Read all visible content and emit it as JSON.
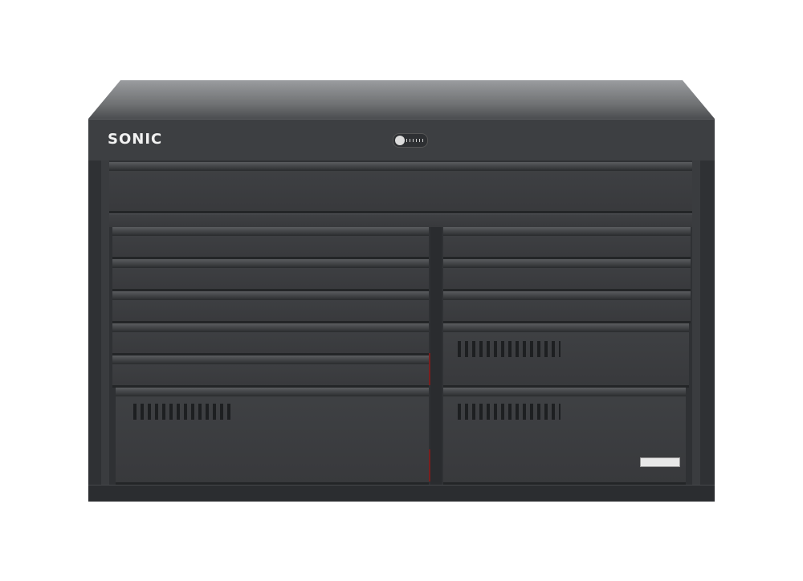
{
  "brand": {
    "logo_text": "SONIC"
  },
  "product": {
    "label_plate": ""
  },
  "icons": {
    "lock": "lock-icon"
  },
  "colors": {
    "body": "#2f3134",
    "lid": "#6f7173",
    "logo": "#f2f2f2"
  }
}
